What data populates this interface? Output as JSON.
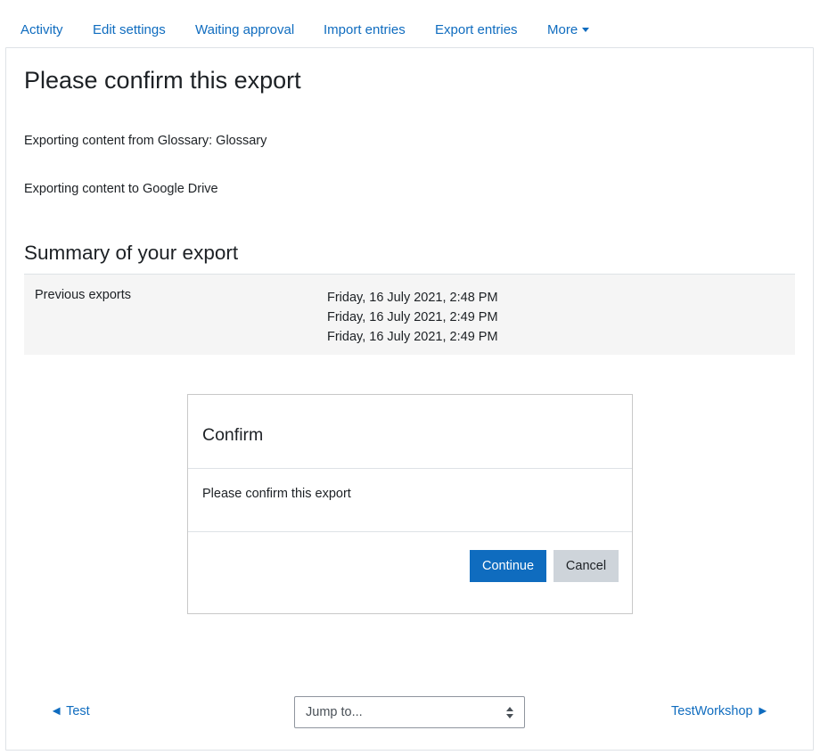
{
  "tabs": [
    {
      "label": "Activity"
    },
    {
      "label": "Edit settings"
    },
    {
      "label": "Waiting approval"
    },
    {
      "label": "Import entries"
    },
    {
      "label": "Export entries"
    },
    {
      "label": "More"
    }
  ],
  "page": {
    "title": "Please confirm this export",
    "exporting_from": "Exporting content from Glossary: Glossary",
    "exporting_to": "Exporting content to Google Drive"
  },
  "summary": {
    "heading": "Summary of your export",
    "label": "Previous exports",
    "values": [
      "Friday, 16 July 2021, 2:48 PM",
      "Friday, 16 July 2021, 2:49 PM",
      "Friday, 16 July 2021, 2:49 PM"
    ]
  },
  "confirm": {
    "title": "Confirm",
    "message": "Please confirm this export",
    "continue_label": "Continue",
    "cancel_label": "Cancel"
  },
  "nav": {
    "prev_label": "◄ Test",
    "next_label": "TestWorkshop ►",
    "jump_placeholder": "Jump to..."
  }
}
